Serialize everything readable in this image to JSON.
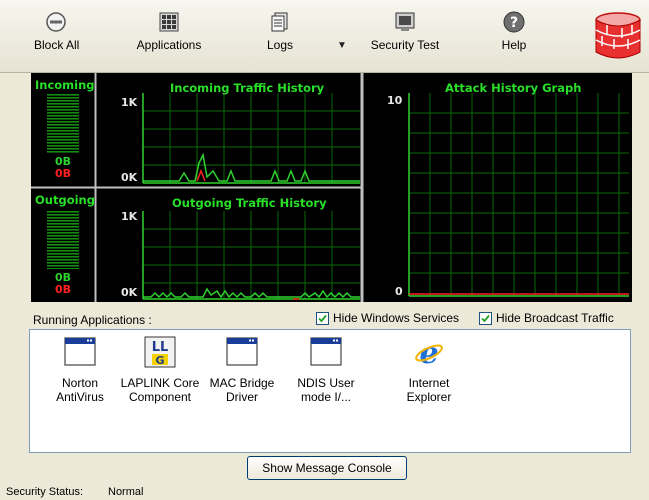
{
  "toolbar": {
    "block_all": "Block All",
    "applications": "Applications",
    "logs": "Logs",
    "security_test": "Security Test",
    "help": "Help",
    "logs_dropdown": "▼"
  },
  "monitor": {
    "incoming_meter_label": "Incoming",
    "outgoing_meter_label": "Outgoing",
    "incoming_val_green": "0B",
    "incoming_val_red": "0B",
    "outgoing_val_green": "0B",
    "outgoing_val_red": "0B",
    "incoming_title": "Incoming Traffic History",
    "outgoing_title": "Outgoing Traffic History",
    "attack_title": "Attack History Graph",
    "axis_1k": "1K",
    "axis_0k": "0K",
    "axis_10": "10",
    "axis_0": "0"
  },
  "apps_section": {
    "label": "Running Applications :",
    "hide_windows_services": "Hide Windows Services",
    "hide_broadcast_traffic": "Hide Broadcast Traffic",
    "items": [
      {
        "line1": "Norton",
        "line2": "AntiVirus",
        "icon": "window-icon"
      },
      {
        "line1": "LAPLINK Core",
        "line2": "Component",
        "icon": "laplink-icon"
      },
      {
        "line1": "MAC Bridge",
        "line2": "Driver",
        "icon": "window-icon"
      },
      {
        "line1": "NDIS User",
        "line2": "mode I/...",
        "icon": "window-icon"
      },
      {
        "line1": "Internet",
        "line2": "Explorer",
        "icon": "internet-explorer-icon"
      }
    ]
  },
  "message_console_button": "Show Message Console",
  "status": {
    "label": "Security Status:",
    "value": "Normal"
  },
  "colors": {
    "graph_green": "#2fd22f",
    "grid_green": "#0a6a0a",
    "alert_red": "#ff2020"
  }
}
